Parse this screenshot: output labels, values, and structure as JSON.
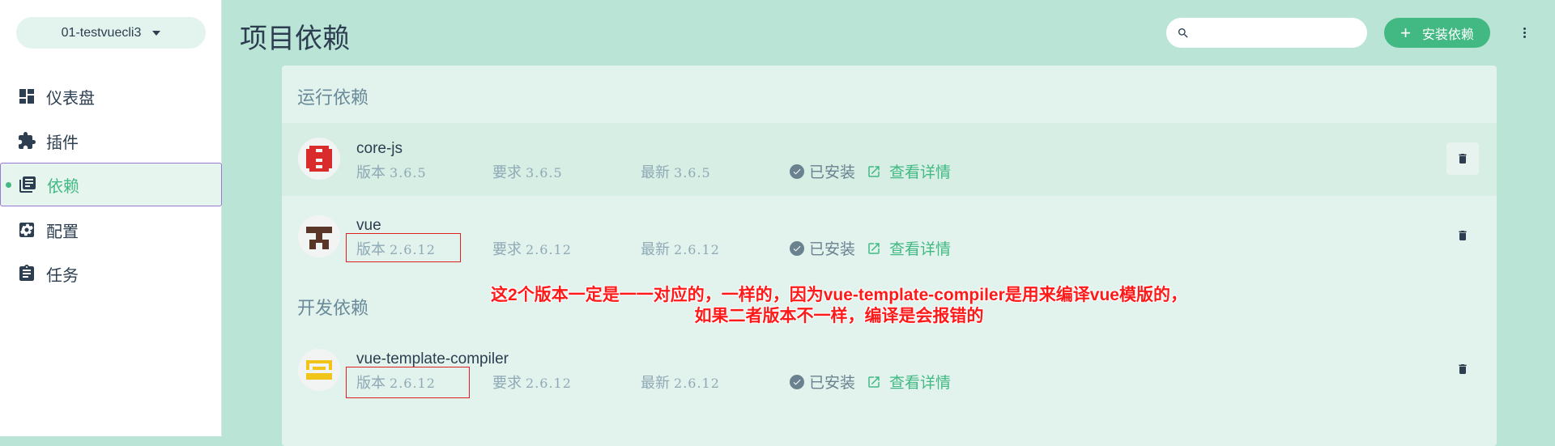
{
  "sidebar": {
    "project_name": "01-testvuecli3",
    "items": [
      {
        "label": "仪表盘",
        "icon": "dashboard-icon"
      },
      {
        "label": "插件",
        "icon": "puzzle-icon"
      },
      {
        "label": "依赖",
        "icon": "library-icon",
        "selected": true
      },
      {
        "label": "配置",
        "icon": "settings-icon"
      },
      {
        "label": "任务",
        "icon": "clipboard-icon"
      }
    ]
  },
  "header": {
    "title": "项目依赖",
    "search_placeholder": "",
    "install_label": "安装依赖"
  },
  "sections": {
    "runtime_title": "运行依赖",
    "dev_title": "开发依赖"
  },
  "dependencies": [
    {
      "name": "core-js",
      "version_label": "版本",
      "version": "3.6.5",
      "required_label": "要求",
      "required": "3.6.5",
      "latest_label": "最新",
      "latest": "3.6.5",
      "status": "已安装",
      "detail": "查看详情",
      "logo_color": "#d92b2b"
    },
    {
      "name": "vue",
      "version_label": "版本",
      "version": "2.6.12",
      "required_label": "要求",
      "required": "2.6.12",
      "latest_label": "最新",
      "latest": "2.6.12",
      "status": "已安装",
      "detail": "查看详情",
      "logo_color": "#5a3628"
    },
    {
      "name": "vue-template-compiler",
      "version_label": "版本",
      "version": "2.6.12",
      "required_label": "要求",
      "required": "2.6.12",
      "latest_label": "最新",
      "latest": "2.6.12",
      "status": "已安装",
      "detail": "查看详情",
      "logo_color": "#f0c419"
    }
  ],
  "annotation": {
    "line1": "这2个版本一定是一一对应的，一样的，因为vue-template-compiler是用来编译vue模版的，",
    "line2": "如果二者版本不一样，编译是会报错的"
  },
  "colors": {
    "accent": "#42b983",
    "background": "#b9e4d6",
    "annotation": "#ff1a1a"
  }
}
